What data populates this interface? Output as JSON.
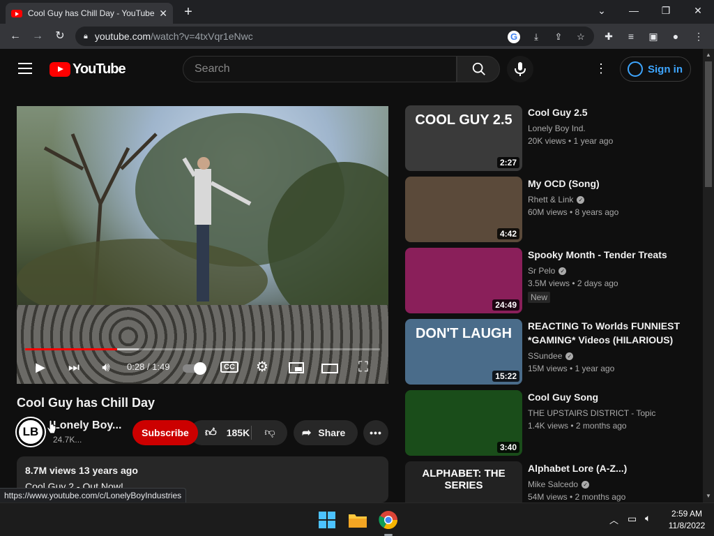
{
  "browser": {
    "tab_title": "Cool Guy has Chill Day - YouTube",
    "tab_close": "✕",
    "new_tab": "+",
    "url_domain": "youtube.com",
    "url_rest": "/watch?v=4txVqr1eNwc",
    "status_url": "https://www.youtube.com/c/LonelyBoyIndustries"
  },
  "header": {
    "logo_text": "YouTube",
    "search_placeholder": "Search",
    "signin_label": "Sign in"
  },
  "player": {
    "time": "0:28 / 1:49",
    "progress": 0.26,
    "buffered": 0.32
  },
  "video": {
    "title": "Cool Guy has Chill Day",
    "channel_initials": "LB",
    "channel_name": "Lonely Boy...",
    "subscribers": "24.7K...",
    "subscribe_label": "Subscribe",
    "likes": "185K",
    "share_label": "Share",
    "more_label": "•••",
    "desc_stats": "8.7M views  13 years ago",
    "desc_text": "Cool Guy 2 - Out Now!"
  },
  "recommendations": [
    {
      "title": "Cool Guy 2.5",
      "channel": "Lonely Boy Ind.",
      "verified": false,
      "meta": "20K views  • 1 year ago",
      "duration": "2:27",
      "thumb_text": "COOL GUY 2.5",
      "color": "#3a3a3a"
    },
    {
      "title": "My OCD (Song)",
      "channel": "Rhett & Link",
      "verified": true,
      "meta": "60M views  • 8 years ago",
      "duration": "4:42",
      "color": "#5b4a3a"
    },
    {
      "title": "Spooky Month - Tender Treats",
      "channel": "Sr Pelo",
      "verified": true,
      "meta": "3.5M views  • 2 days ago",
      "badge": "New",
      "duration": "24:49",
      "color": "#8a1f5a"
    },
    {
      "title": "REACTING To Worlds FUNNIEST *GAMING* Videos (HILARIOUS)",
      "channel": "SSundee",
      "verified": true,
      "meta": "15M views  • 1 year ago",
      "duration": "15:22",
      "thumb_text": "DON'T LAUGH",
      "color": "#4a6c8a"
    },
    {
      "title": "Cool Guy Song",
      "channel": "THE UPSTAIRS DISTRICT - Topic",
      "verified": false,
      "meta": "1.4K views  • 2 months ago",
      "duration": "3:40",
      "color": "#1a4d1a"
    },
    {
      "title": "Alphabet Lore (A-Z...)",
      "channel": "Mike Salcedo",
      "verified": true,
      "meta": "54M views  • 2 months ago",
      "thumb_text": "ALPHABET: THE SERIES",
      "color": "#222"
    }
  ],
  "clock": {
    "time": "2:59 AM",
    "date": "11/8/2022"
  }
}
